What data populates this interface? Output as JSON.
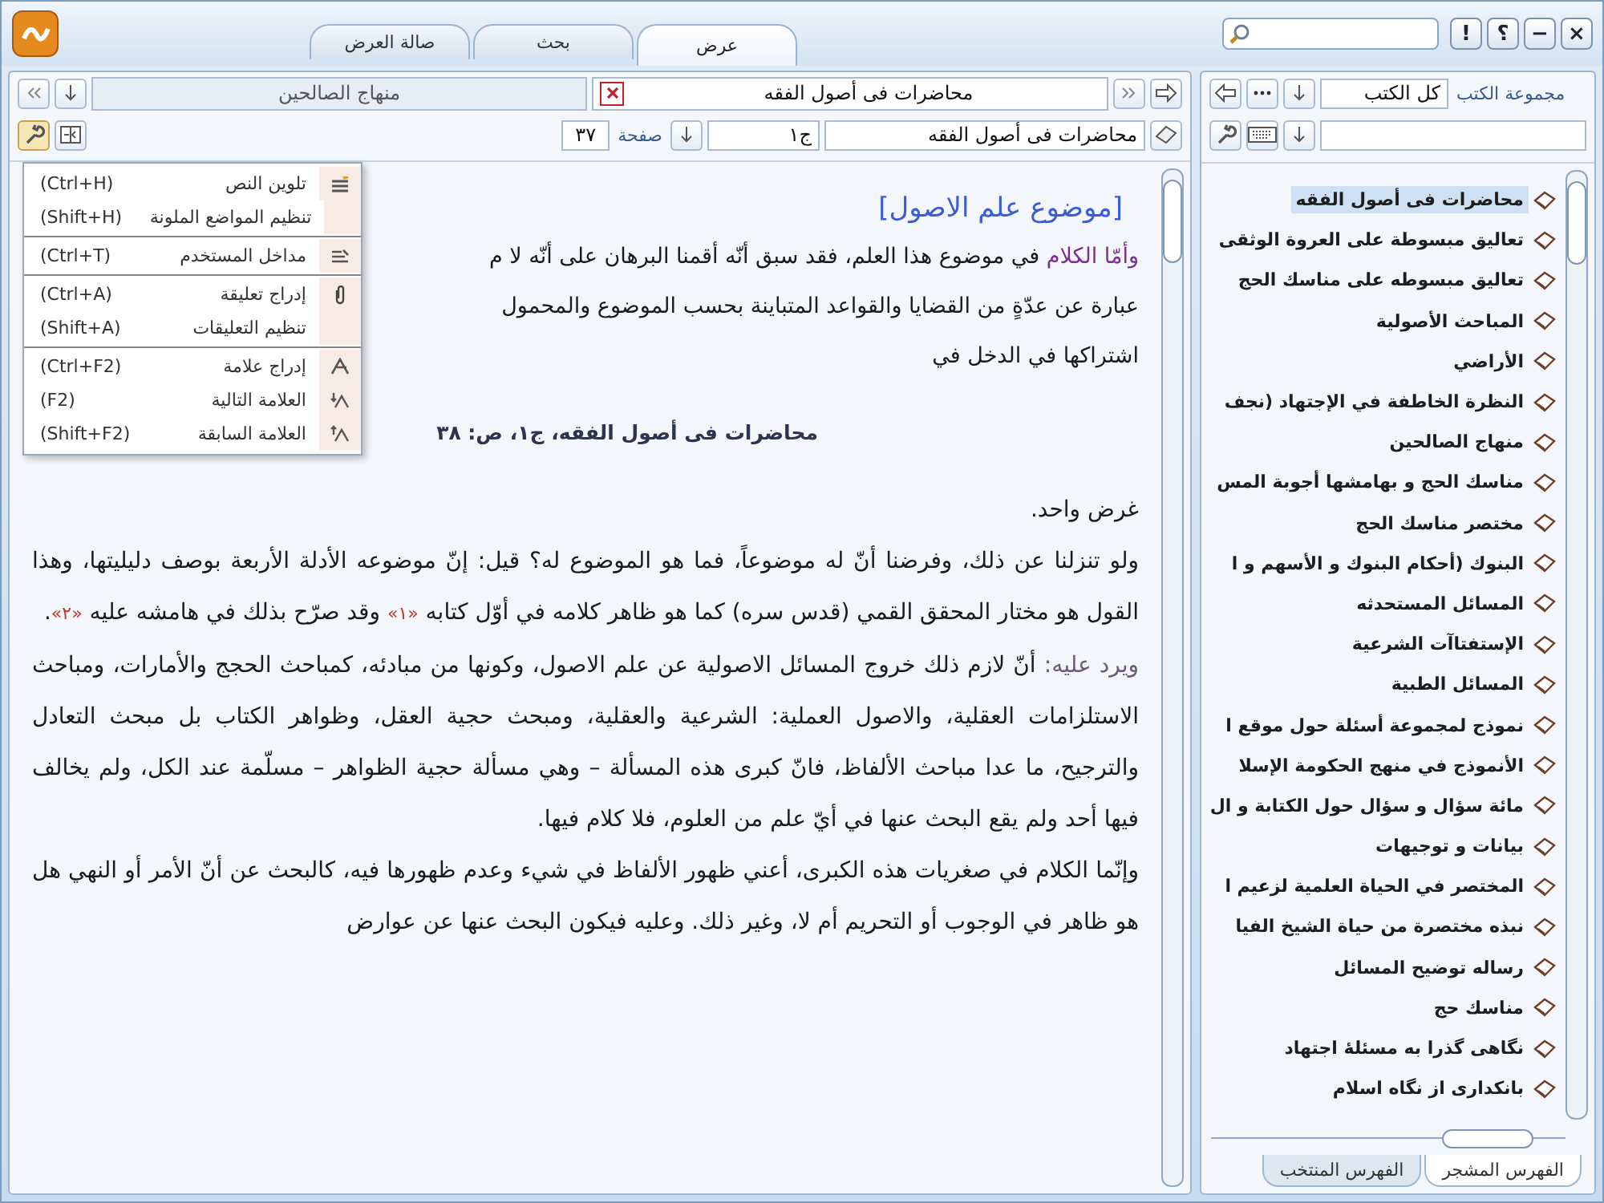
{
  "tabs": [
    {
      "label": "عرض",
      "selected": true
    },
    {
      "label": "بحث",
      "selected": false
    },
    {
      "label": "صالة العرض",
      "selected": false
    }
  ],
  "window_buttons": [
    "×",
    "−",
    "؟",
    "!"
  ],
  "book_view": {
    "open_books": [
      {
        "title": "محاضرات فى أصول الفقه",
        "selected": true
      },
      {
        "title": "منهاج الصالحين",
        "selected": false
      }
    ],
    "book_field": "محاضرات فى أصول الفقه",
    "volume_field": "ج١",
    "page_label": "صفحة",
    "page_value": "٣٧",
    "menu": [
      [
        {
          "kind": "highlight",
          "label": "تلوين النص",
          "shortcut": "(Ctrl+H)"
        },
        {
          "kind": "plain",
          "label": "تنظيم المواضع الملونة",
          "shortcut": "(Shift+H)"
        }
      ],
      [
        {
          "kind": "user",
          "label": "مداخل المستخدم",
          "shortcut": "(Ctrl+T)"
        }
      ],
      [
        {
          "kind": "comment",
          "label": "إدراج تعليقة",
          "shortcut": "(Ctrl+A)"
        },
        {
          "kind": "plain",
          "label": "تنظيم التعليقات",
          "shortcut": "(Shift+A)"
        }
      ],
      [
        {
          "kind": "bookmark",
          "label": "إدراج علامة",
          "shortcut": "(Ctrl+F2)"
        },
        {
          "kind": "next",
          "label": "العلامة التالية",
          "shortcut": "(F2)"
        },
        {
          "kind": "previous",
          "label": "العلامة السابقة",
          "shortcut": "(Shift+F2)"
        }
      ]
    ],
    "heading": "[موضوع علم الاصول]",
    "partial_lines": [
      [
        {
          "kind": "lead",
          "text": "وأمّا الكلام"
        },
        {
          "kind": "text",
          "text": " في موضوع هذا العلم، فقد سبق أنّه أقمنا البرهان على أنّه لا م"
        }
      ],
      [
        {
          "kind": "text",
          "text": "عبارة عن عدّةٍ من القضايا والقواعد المتباينة بحسب الموضوع والمحمول"
        }
      ],
      [
        {
          "kind": "text",
          "text": "اشتراكها في الدخل في"
        }
      ]
    ],
    "citation": "محاضرات فى أصول الفقه، ج١، ص: ٣٨",
    "paragraphs": [
      [
        {
          "kind": "text",
          "text": "غرض واحد."
        }
      ],
      [
        {
          "kind": "text",
          "text": "ولو تنزلنا عن ذلك، وفرضنا أنّ له موضوعاً، فما هو الموضوع له؟ قيل: إنّ موضوعه الأدلة الأربعة بوصف دليليتها، وهذا القول هو مختار المحقق القمي (قدس سره) كما هو ظاهر كلامه في أوّل كتابه "
        },
        {
          "kind": "note",
          "text": "«١»"
        },
        {
          "kind": "text",
          "text": " وقد صرّح بذلك في هامشه عليه "
        },
        {
          "kind": "note",
          "text": "«٢»"
        },
        {
          "kind": "text",
          "text": "."
        }
      ],
      [
        {
          "kind": "aside",
          "text": "ويرد عليه: "
        },
        {
          "kind": "text",
          "text": "أنّ لازم ذلك خروج المسائل الاصولية عن علم الاصول، وكونها من مبادئه، كمباحث الحجج والأمارات، ومباحث الاستلزامات العقلية، والاصول العملية: الشرعية والعقلية، ومبحث حجية العقل، وظواهر الكتاب بل مبحث التعادل والترجيح، ما عدا مباحث الألفاظ، فانّ كبرى هذه المسألة – وهي مسألة حجية الظواهر – مسلّمة عند الكل، ولم يخالف فيها أحد ولم يقع البحث عنها في أيّ علم من العلوم، فلا كلام فيها."
        }
      ],
      [
        {
          "kind": "text",
          "text": "وإنّما الكلام في صغريات هذه الكبرى، أعني ظهور الألفاظ في شيء وعدم ظهورها فيه، كالبحث عن أنّ الأمر أو النهي هل هو ظاهر في الوجوب أو التحريم أم لا، وغير ذلك. وعليه فيكون البحث عنها عن عوارض"
        }
      ]
    ]
  },
  "library": {
    "group_label": "مجموعة الكتب",
    "group_value": "كل الكتب",
    "books": [
      {
        "label": "محاضرات فى أصول الفقه",
        "selected": true
      },
      {
        "label": "تعاليق مبسوطة على العروة الوثقى",
        "selected": false
      },
      {
        "label": "تعاليق مبسوطه على مناسك الحج",
        "selected": false
      },
      {
        "label": "المباحث الأصولية",
        "selected": false
      },
      {
        "label": "الأراضي",
        "selected": false
      },
      {
        "label": "النظرة الخاطفة في الإجتهاد (نجف",
        "selected": false
      },
      {
        "label": "منهاج الصالحين",
        "selected": false
      },
      {
        "label": "مناسك الحج و بهامشها أجوبة المس",
        "selected": false
      },
      {
        "label": "مختصر مناسك الحج",
        "selected": false
      },
      {
        "label": "البنوك (أحكام البنوك و الأسهم و ا",
        "selected": false
      },
      {
        "label": "المسائل المستحدثه",
        "selected": false
      },
      {
        "label": "الإستفتاآت الشرعية",
        "selected": false
      },
      {
        "label": "المسائل الطبية",
        "selected": false
      },
      {
        "label": "نموذج لمجموعة أسئلة حول موقع ا",
        "selected": false
      },
      {
        "label": "الأنموذج في منهج الحكومة الإسلا",
        "selected": false
      },
      {
        "label": "مائة سؤال و سؤال حول الكتابة و ال",
        "selected": false
      },
      {
        "label": "بيانات و توجيهات",
        "selected": false
      },
      {
        "label": "المختصر في الحياة العلمية لزعيم ا",
        "selected": false
      },
      {
        "label": "نبذه مختصرة من حياة الشيخ الفيا",
        "selected": false
      },
      {
        "label": "رساله توضيح المسائل",
        "selected": false
      },
      {
        "label": "مناسك حج",
        "selected": false
      },
      {
        "label": "نگاهی گذرا به مسئلهٔ اجتهاد",
        "selected": false
      },
      {
        "label": "بانکداری از نگاه اسلام",
        "selected": false
      }
    ],
    "bottom_tabs": [
      {
        "label": "الفهرس المشجر",
        "selected": true
      },
      {
        "label": "الفهرس المنتخب",
        "selected": false
      }
    ]
  }
}
